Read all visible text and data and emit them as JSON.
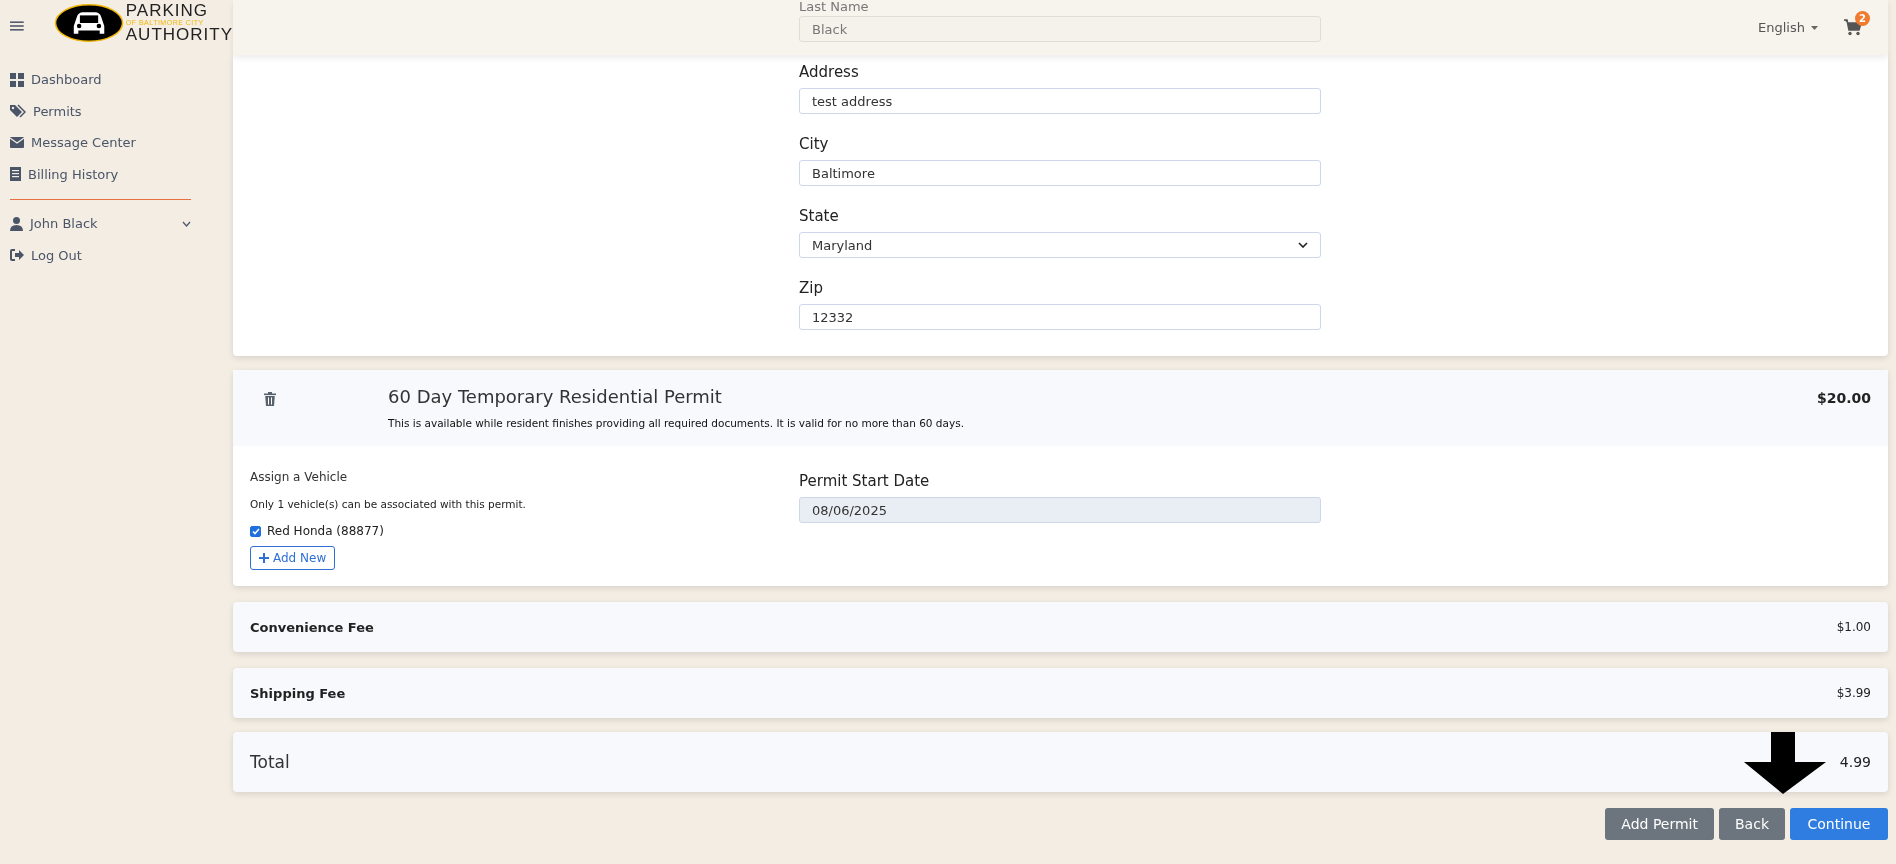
{
  "logo": {
    "line1": "PARKING",
    "line2": "OF BALTIMORE CITY",
    "line3": "AUTHORITY"
  },
  "header": {
    "language": "English",
    "cart_count": "2"
  },
  "sidebar": {
    "items": [
      {
        "label": "Dashboard"
      },
      {
        "label": "Permits"
      },
      {
        "label": "Message Center"
      },
      {
        "label": "Billing History"
      }
    ],
    "user": {
      "label": "John Black",
      "expanded": false
    },
    "logout": "Log Out"
  },
  "contact_form": {
    "fields": [
      {
        "label": "Last Name",
        "value": "Black",
        "kind": "text",
        "disabled": true
      },
      {
        "label": "Address",
        "value": "test address",
        "kind": "text",
        "disabled": false
      },
      {
        "label": "City",
        "value": "Baltimore",
        "kind": "text",
        "disabled": false
      },
      {
        "label": "State",
        "value": "Maryland",
        "kind": "select",
        "disabled": false
      },
      {
        "label": "Zip",
        "value": "12332",
        "kind": "text",
        "disabled": false
      }
    ]
  },
  "permit": {
    "title": "60 Day Temporary Residential Permit",
    "description": "This is available while resident finishes providing all required documents. It is valid for no more than 60 days.",
    "price": "$20.00",
    "assign_label": "Assign a Vehicle",
    "limit_note": "Only 1 vehicle(s) can be associated with this permit.",
    "vehicles": [
      {
        "label": "Red Honda (88877)",
        "checked": true
      }
    ],
    "add_button": "Add New",
    "start_date_label": "Permit Start Date",
    "start_date": "08/06/2025"
  },
  "fees": [
    {
      "label": "Convenience Fee",
      "amount": "$1.00"
    },
    {
      "label": "Shipping Fee",
      "amount": "$3.99"
    }
  ],
  "total": {
    "label": "Total",
    "amount": "4.99"
  },
  "buttons": [
    {
      "label": "Add Permit",
      "kind": "secondary"
    },
    {
      "label": "Back",
      "kind": "secondary"
    },
    {
      "label": "Continue",
      "kind": "primary"
    }
  ]
}
